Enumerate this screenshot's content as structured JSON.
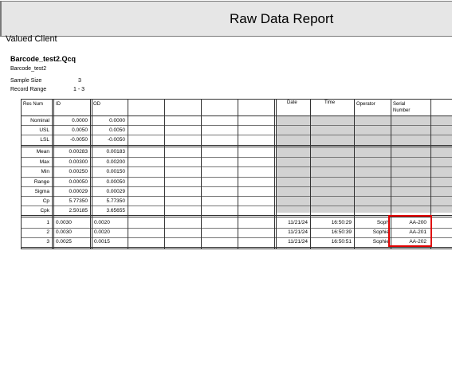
{
  "report": {
    "title": "Raw Data Report",
    "client": "Valued Client",
    "file_name": "Barcode_test2.Qcq",
    "part_name": "Barcode_test2",
    "sample_size_label": "Sample Size",
    "sample_size_value": "3",
    "record_range_label": "Record Range",
    "record_range_value": "1 - 3"
  },
  "table": {
    "headers": {
      "res_num": "Res Num",
      "id": "ID",
      "od": "OD",
      "date": "Date",
      "time": "Time",
      "operator": "Operator",
      "serial_1": "Serial",
      "serial_2": "Number"
    },
    "spec_rows": [
      {
        "label": "Nominal",
        "id": "0.0000",
        "od": "0.0000"
      },
      {
        "label": "USL",
        "id": "0.0050",
        "od": "0.0050"
      },
      {
        "label": "LSL",
        "id": "-0.0050",
        "od": "-0.0050"
      }
    ],
    "stat_rows": [
      {
        "label": "Mean",
        "id": "0.00283",
        "od": "0.00183"
      },
      {
        "label": "Max",
        "id": "0.00300",
        "od": "0.00200"
      },
      {
        "label": "Min",
        "id": "0.00250",
        "od": "0.00150"
      },
      {
        "label": "Range",
        "id": "0.00050",
        "od": "0.00050"
      },
      {
        "label": "Sigma",
        "id": "0.00029",
        "od": "0.00029"
      },
      {
        "label": "Cp",
        "id": "5.77350",
        "od": "5.77350"
      },
      {
        "label": "Cpk",
        "id": "2.50185",
        "od": "3.65655"
      }
    ],
    "data_rows": [
      {
        "num": "1",
        "id": "0.0030",
        "od": "0.0020",
        "date": "11/21/24",
        "time": "16:50:29",
        "operator": "Soph",
        "serial": "AA-200"
      },
      {
        "num": "2",
        "id": "0.0030",
        "od": "0.0020",
        "date": "11/21/24",
        "time": "16:50:39",
        "operator": "Sophie",
        "serial": "AA-201"
      },
      {
        "num": "3",
        "id": "0.0025",
        "od": "0.0015",
        "date": "11/21/24",
        "time": "16:50:51",
        "operator": "Sophie",
        "serial": "AA-202"
      }
    ]
  },
  "colors": {
    "shaded_area": "#d2d2d2",
    "highlight": "#e00000"
  }
}
